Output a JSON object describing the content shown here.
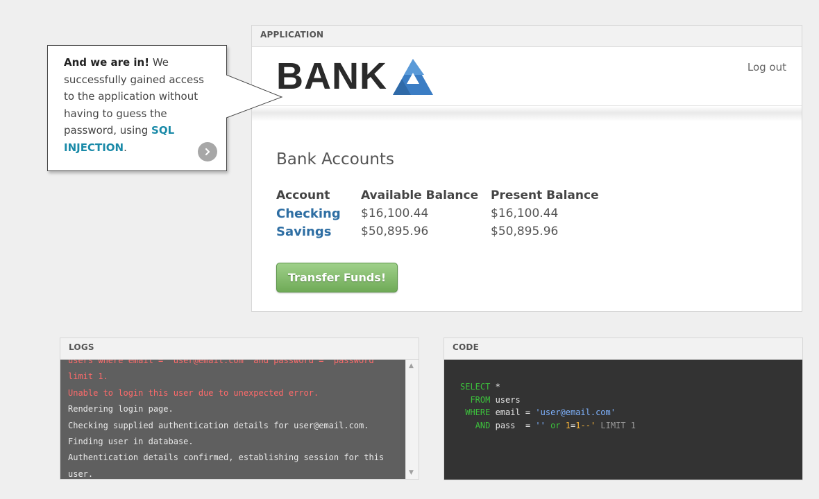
{
  "application": {
    "header": "APPLICATION",
    "logo_text": "BANK",
    "logout_label": "Log out",
    "accounts_title": "Bank Accounts",
    "table": {
      "headers": [
        "Account",
        "Available Balance",
        "Present Balance"
      ],
      "rows": [
        {
          "account": "Checking",
          "available": "$16,100.44",
          "present": "$16,100.44"
        },
        {
          "account": "Savings",
          "available": "$50,895.96",
          "present": "$50,895.96"
        }
      ]
    },
    "transfer_label": "Transfer Funds!"
  },
  "callout": {
    "bold_lead": "And we are in!",
    "text_1": " We successfully gained access to the application without having to guess the password, using ",
    "sql_link": "SQL INJECTION",
    "text_2": "."
  },
  "logs": {
    "header": "LOGS",
    "lines": [
      {
        "text": "users where email = 'user@email.com' and password = 'password'",
        "type": "error"
      },
      {
        "text": "limit 1.",
        "type": "error"
      },
      {
        "text": "Unable to login this user due to unexpected error.",
        "type": "error"
      },
      {
        "text": "Rendering login page.",
        "type": "info"
      },
      {
        "text": "Checking supplied authentication details for user@email.com.",
        "type": "info"
      },
      {
        "text": "Finding user in database.",
        "type": "info"
      },
      {
        "text": "Authentication details confirmed, establishing session for this",
        "type": "info"
      },
      {
        "text": "user.",
        "type": "info"
      }
    ]
  },
  "code": {
    "header": "CODE",
    "line1": {
      "kw": "SELECT",
      "rest": " *"
    },
    "line2": {
      "indent": "  ",
      "kw": "FROM",
      "rest": " users"
    },
    "line3": {
      "indent": " ",
      "kw": "WHERE",
      "mid": " email = ",
      "str": "'user@email.com'"
    },
    "line4": {
      "indent": "   ",
      "kw": "AND",
      "mid": " pass  = ",
      "str1": "''",
      "kw2": " or ",
      "num1": "1",
      "op": "=",
      "num2": "1",
      "cmt": "--'",
      "tail": " LIMIT 1"
    }
  },
  "colors": {
    "accent_link": "#2e6ea3",
    "sql_link": "#1a8aa8",
    "button_green": "#6faa57",
    "log_error": "#ff6b6b",
    "code_keyword": "#3cc23c",
    "code_string": "#7fb3ff",
    "code_number": "#ffb93a",
    "logo_mark": "#3b7dc4"
  },
  "icons": {
    "logo_mark": "triangle-logo-icon",
    "next": "chevron-right-icon",
    "scroll_up": "arrow-up-icon",
    "scroll_down": "arrow-down-icon"
  }
}
